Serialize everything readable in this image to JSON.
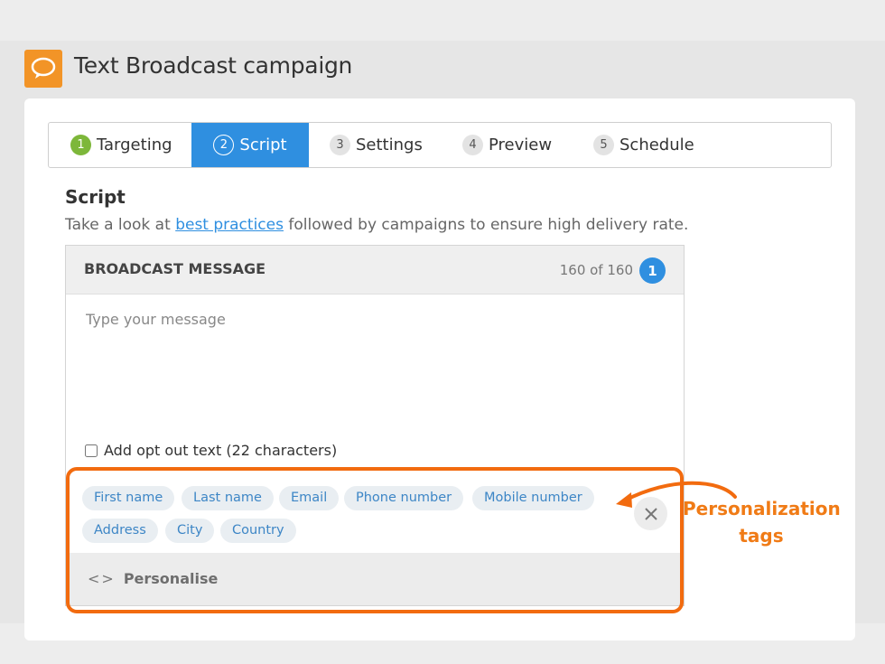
{
  "header": {
    "title": "Text Broadcast campaign",
    "icon": "speech-bubble-icon",
    "accent": "#f29427"
  },
  "tabs": [
    {
      "num": "1",
      "label": "Targeting",
      "state": "done"
    },
    {
      "num": "2",
      "label": "Script",
      "state": "active"
    },
    {
      "num": "3",
      "label": "Settings",
      "state": "pending"
    },
    {
      "num": "4",
      "label": "Preview",
      "state": "pending"
    },
    {
      "num": "5",
      "label": "Schedule",
      "state": "pending"
    }
  ],
  "script": {
    "heading": "Script",
    "desc_before": "Take a look at",
    "link": "best practices",
    "desc_after": "followed by campaigns to ensure high delivery rate."
  },
  "message": {
    "title": "BROADCAST MESSAGE",
    "count": "160 of 160",
    "sms_count": "1",
    "placeholder": "Type your message",
    "value": "",
    "optout_label": "Add opt out text (22 characters)",
    "optout_checked": false
  },
  "tags": [
    "First name",
    "Last name",
    "Email",
    "Phone number",
    "Mobile number",
    "Address",
    "City",
    "Country"
  ],
  "personalise": {
    "icon_text": "<>",
    "label": "Personalise"
  },
  "callout": {
    "line1": "Personalization",
    "line2": "tags",
    "color": "#f26b0f"
  },
  "colors": {
    "primary": "#2f8fe0",
    "done": "#7db73a",
    "tag_text": "#3d86c6"
  }
}
